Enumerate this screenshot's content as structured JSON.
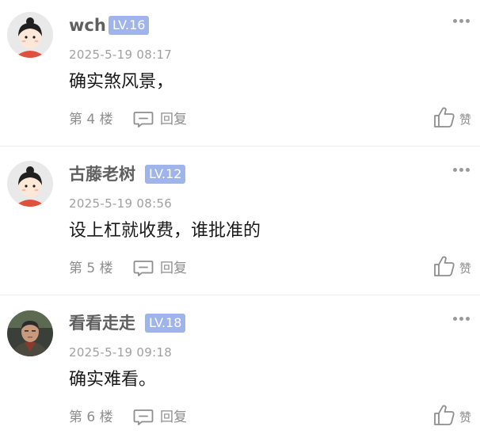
{
  "comments": [
    {
      "username": "wch",
      "level": "LV.16",
      "time": "2025-5-19 08:17",
      "content": "确实煞风景，",
      "floor": "第 4 楼",
      "reply_label": "回复",
      "like_label": "赞",
      "avatar": "cartoon-girl-avatar"
    },
    {
      "username": "古藤老树",
      "level": "LV.12",
      "time": "2025-5-19 08:56",
      "content": "设上杠就收费，谁批准的",
      "floor": "第 5 楼",
      "reply_label": "回复",
      "like_label": "赞",
      "avatar": "cartoon-girl-avatar"
    },
    {
      "username": "看看走走",
      "level": "LV.18",
      "time": "2025-5-19 09:18",
      "content": "确实难看。",
      "floor": "第 6 楼",
      "reply_label": "回复",
      "like_label": "赞",
      "avatar": "man-photo-avatar"
    }
  ],
  "colors": {
    "level_badge_bg": "#9fb4ea",
    "username": "#5f5f5f",
    "meta_text": "#8e8e8e",
    "divider": "#ececec"
  }
}
